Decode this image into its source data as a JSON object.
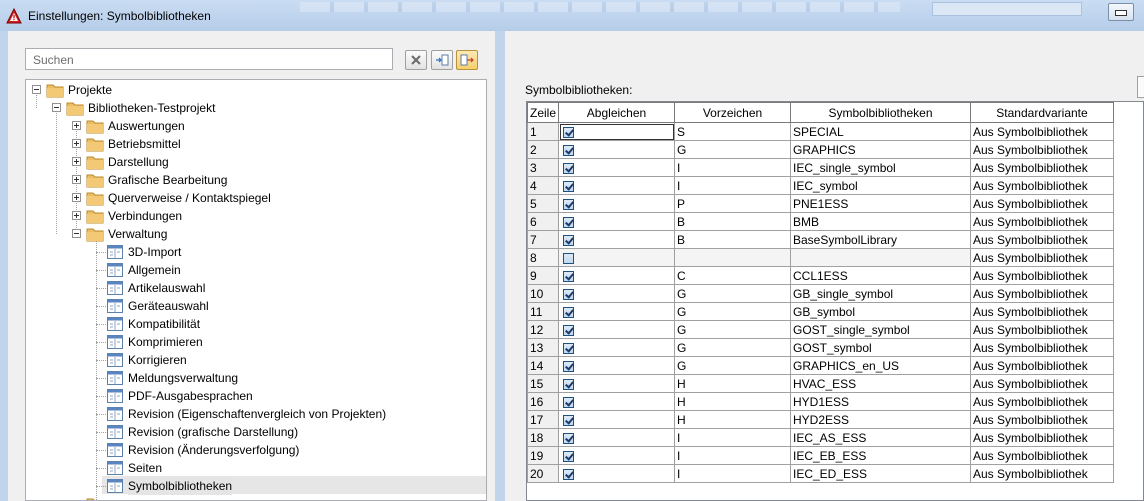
{
  "window": {
    "title": "Einstellungen: Symbolbibliotheken",
    "app_icon": "eplan-warning-icon"
  },
  "search": {
    "placeholder": "Suchen"
  },
  "toolbar": {
    "icons": [
      "clear-filter-icon",
      "collapse-icon",
      "expand-icon"
    ]
  },
  "tree": {
    "items": [
      {
        "label": "Projekte",
        "level": 0,
        "type": "folder",
        "expanded": true
      },
      {
        "label": "Bibliotheken-Testprojekt",
        "level": 1,
        "type": "folder",
        "expanded": true
      },
      {
        "label": "Auswertungen",
        "level": 2,
        "type": "folder",
        "expanded": false
      },
      {
        "label": "Betriebsmittel",
        "level": 2,
        "type": "folder",
        "expanded": false
      },
      {
        "label": "Darstellung",
        "level": 2,
        "type": "folder",
        "expanded": false
      },
      {
        "label": "Grafische Bearbeitung",
        "level": 2,
        "type": "folder",
        "expanded": false
      },
      {
        "label": "Querverweise / Kontaktspiegel",
        "level": 2,
        "type": "folder",
        "expanded": false
      },
      {
        "label": "Verbindungen",
        "level": 2,
        "type": "folder",
        "expanded": false
      },
      {
        "label": "Verwaltung",
        "level": 2,
        "type": "folder",
        "expanded": true
      },
      {
        "label": "3D-Import",
        "level": 3,
        "type": "page"
      },
      {
        "label": "Allgemein",
        "level": 3,
        "type": "page"
      },
      {
        "label": "Artikelauswahl",
        "level": 3,
        "type": "page"
      },
      {
        "label": "Geräteauswahl",
        "level": 3,
        "type": "page"
      },
      {
        "label": "Kompatibilität",
        "level": 3,
        "type": "page"
      },
      {
        "label": "Komprimieren",
        "level": 3,
        "type": "page"
      },
      {
        "label": "Korrigieren",
        "level": 3,
        "type": "page"
      },
      {
        "label": "Meldungsverwaltung",
        "level": 3,
        "type": "page"
      },
      {
        "label": "PDF-Ausgabesprachen",
        "level": 3,
        "type": "page"
      },
      {
        "label": "Revision (Eigenschaftenvergleich von Projekten)",
        "level": 3,
        "type": "page"
      },
      {
        "label": "Revision (grafische Darstellung)",
        "level": 3,
        "type": "page"
      },
      {
        "label": "Revision (Änderungsverfolgung)",
        "level": 3,
        "type": "page"
      },
      {
        "label": "Seiten",
        "level": 3,
        "type": "page"
      },
      {
        "label": "Symbolbibliotheken",
        "level": 3,
        "type": "page",
        "selected": true
      }
    ]
  },
  "main": {
    "section_label": "Symbolbibliotheken:",
    "columns": [
      "Zeile",
      "Abgleichen",
      "Vorzeichen",
      "Symbolbibliotheken",
      "Standardvariante"
    ],
    "rows": [
      {
        "zeile": "1",
        "abgleichen": true,
        "vorzeichen": "S",
        "bibliothek": "SPECIAL",
        "standard": "Aus Symbolbibliothek"
      },
      {
        "zeile": "2",
        "abgleichen": true,
        "vorzeichen": "G",
        "bibliothek": "GRAPHICS",
        "standard": "Aus Symbolbibliothek"
      },
      {
        "zeile": "3",
        "abgleichen": true,
        "vorzeichen": "I",
        "bibliothek": "IEC_single_symbol",
        "standard": "Aus Symbolbibliothek"
      },
      {
        "zeile": "4",
        "abgleichen": true,
        "vorzeichen": "I",
        "bibliothek": "IEC_symbol",
        "standard": "Aus Symbolbibliothek"
      },
      {
        "zeile": "5",
        "abgleichen": true,
        "vorzeichen": "P",
        "bibliothek": "PNE1ESS",
        "standard": "Aus Symbolbibliothek"
      },
      {
        "zeile": "6",
        "abgleichen": true,
        "vorzeichen": "B",
        "bibliothek": "BMB",
        "standard": "Aus Symbolbibliothek"
      },
      {
        "zeile": "7",
        "abgleichen": true,
        "vorzeichen": "B",
        "bibliothek": "BaseSymbolLibrary",
        "standard": "Aus Symbolbibliothek"
      },
      {
        "zeile": "8",
        "abgleichen": false,
        "vorzeichen": "",
        "bibliothek": "",
        "standard": "Aus Symbolbibliothek"
      },
      {
        "zeile": "9",
        "abgleichen": true,
        "vorzeichen": "C",
        "bibliothek": "CCL1ESS",
        "standard": "Aus Symbolbibliothek"
      },
      {
        "zeile": "10",
        "abgleichen": true,
        "vorzeichen": "G",
        "bibliothek": "GB_single_symbol",
        "standard": "Aus Symbolbibliothek"
      },
      {
        "zeile": "11",
        "abgleichen": true,
        "vorzeichen": "G",
        "bibliothek": "GB_symbol",
        "standard": "Aus Symbolbibliothek"
      },
      {
        "zeile": "12",
        "abgleichen": true,
        "vorzeichen": "G",
        "bibliothek": "GOST_single_symbol",
        "standard": "Aus Symbolbibliothek"
      },
      {
        "zeile": "13",
        "abgleichen": true,
        "vorzeichen": "G",
        "bibliothek": "GOST_symbol",
        "standard": "Aus Symbolbibliothek"
      },
      {
        "zeile": "14",
        "abgleichen": true,
        "vorzeichen": "G",
        "bibliothek": "GRAPHICS_en_US",
        "standard": "Aus Symbolbibliothek"
      },
      {
        "zeile": "15",
        "abgleichen": true,
        "vorzeichen": "H",
        "bibliothek": "HVAC_ESS",
        "standard": "Aus Symbolbibliothek"
      },
      {
        "zeile": "16",
        "abgleichen": true,
        "vorzeichen": "H",
        "bibliothek": "HYD1ESS",
        "standard": "Aus Symbolbibliothek"
      },
      {
        "zeile": "17",
        "abgleichen": true,
        "vorzeichen": "H",
        "bibliothek": "HYD2ESS",
        "standard": "Aus Symbolbibliothek"
      },
      {
        "zeile": "18",
        "abgleichen": true,
        "vorzeichen": "I",
        "bibliothek": "IEC_AS_ESS",
        "standard": "Aus Symbolbibliothek"
      },
      {
        "zeile": "19",
        "abgleichen": true,
        "vorzeichen": "I",
        "bibliothek": "IEC_EB_ESS",
        "standard": "Aus Symbolbibliothek"
      },
      {
        "zeile": "20",
        "abgleichen": true,
        "vorzeichen": "I",
        "bibliothek": "IEC_ED_ESS",
        "standard": "Aus Symbolbibliothek"
      }
    ]
  },
  "colors": {
    "folder": "#e9b65a",
    "selection": "#e6e6e6",
    "accent": "#c1d4ec"
  }
}
